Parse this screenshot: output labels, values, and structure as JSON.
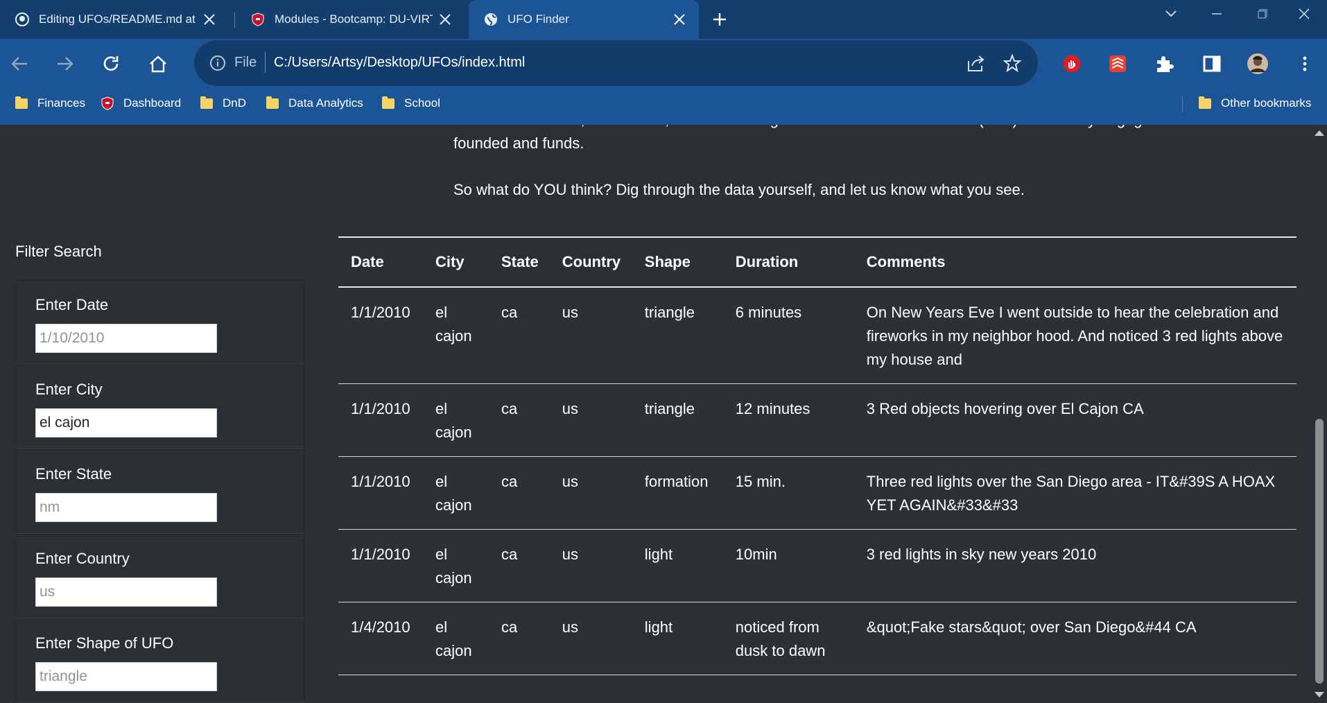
{
  "browser": {
    "tabs": [
      {
        "title": "Editing UFOs/README.md at m",
        "favicon": "github-icon",
        "active": false
      },
      {
        "title": "Modules - Bootcamp: DU-VIRT",
        "favicon": "shield-icon",
        "active": false
      },
      {
        "title": "UFO Finder",
        "favicon": "globe-icon",
        "active": true
      }
    ],
    "address": {
      "scheme_label": "File",
      "url": "C:/Users/Artsy/Desktop/UFOs/index.html"
    },
    "bookmarks": [
      {
        "label": "Finances",
        "icon": "folder-icon"
      },
      {
        "label": "Dashboard",
        "icon": "shield-icon"
      },
      {
        "label": "DnD",
        "icon": "folder-icon"
      },
      {
        "label": "Data Analytics",
        "icon": "folder-icon"
      },
      {
        "label": "School",
        "icon": "folder-icon"
      }
    ],
    "other_bookmarks": "Other bookmarks"
  },
  "article": {
    "cut_line": "like to be left alone,\" she stated, before directing us to the Leave Aliens Alone (LAA) community engagement initiative she",
    "p1_tail": "founded and funds.",
    "p2": "So what do YOU think? Dig through the data yourself, and let us know what you see."
  },
  "filters": {
    "heading": "Filter Search",
    "date": {
      "label": "Enter Date",
      "placeholder": "1/10/2010",
      "value": ""
    },
    "city": {
      "label": "Enter City",
      "placeholder": "",
      "value": "el cajon"
    },
    "state": {
      "label": "Enter State",
      "placeholder": "nm",
      "value": ""
    },
    "country": {
      "label": "Enter Country",
      "placeholder": "us",
      "value": ""
    },
    "shape": {
      "label": "Enter Shape of UFO",
      "placeholder": "triangle",
      "value": ""
    }
  },
  "table": {
    "headers": [
      "Date",
      "City",
      "State",
      "Country",
      "Shape",
      "Duration",
      "Comments"
    ],
    "rows": [
      [
        "1/1/2010",
        "el cajon",
        "ca",
        "us",
        "triangle",
        "6 minutes",
        "On New Years Eve I went outside to hear the celebration and fireworks in my neighbor hood. And noticed 3 red lights above my house and"
      ],
      [
        "1/1/2010",
        "el cajon",
        "ca",
        "us",
        "triangle",
        "12 minutes",
        "3 Red objects hovering over El Cajon CA"
      ],
      [
        "1/1/2010",
        "el cajon",
        "ca",
        "us",
        "formation",
        "15 min.",
        "Three red lights over the San Diego area - IT&#39S A HOAX YET AGAIN&#33&#33"
      ],
      [
        "1/1/2010",
        "el cajon",
        "ca",
        "us",
        "light",
        "10min",
        "3 red lights in sky new years 2010"
      ],
      [
        "1/4/2010",
        "el cajon",
        "ca",
        "us",
        "light",
        "noticed from dusk to dawn",
        "&quot;Fake stars&quot; over San Diego&#44 CA"
      ]
    ]
  },
  "colors": {
    "chrome_dark": "#143e6e",
    "chrome_toolbar": "#1b5596",
    "page_bg": "#2b3035",
    "text": "#ffffff"
  }
}
